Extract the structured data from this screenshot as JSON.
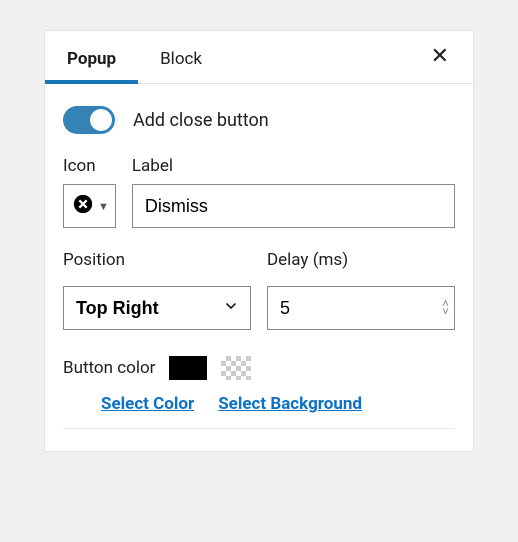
{
  "tabs": {
    "popup": "Popup",
    "block": "Block"
  },
  "close_button_toggle": {
    "label": "Add close button",
    "enabled": true
  },
  "icon_field": {
    "title": "Icon"
  },
  "label_field": {
    "title": "Label",
    "value": "Dismiss"
  },
  "position_field": {
    "title": "Position",
    "value": "Top Right"
  },
  "delay_field": {
    "title": "Delay (ms)",
    "value": "5"
  },
  "button_color": {
    "title": "Button color",
    "solid": "#000000"
  },
  "links": {
    "color": "Select Color",
    "background": "Select Background"
  }
}
